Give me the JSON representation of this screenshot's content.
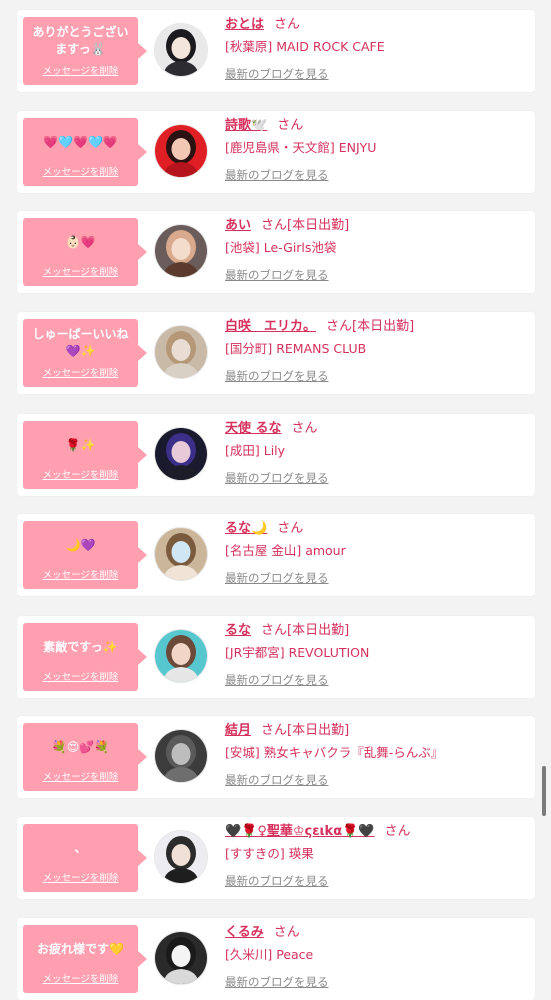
{
  "labels": {
    "san": "さん",
    "delete": "メッセージを削除",
    "blog": "最新のブログを見る"
  },
  "colors": {
    "bubble": "#ff9fb0",
    "name": "#d6305c",
    "muted": "#8a8a8a",
    "background": "#f3f3f3"
  },
  "cards": [
    {
      "message": "ありがとうございますっ🐰",
      "name": "おとは",
      "attendance": "",
      "shop": "[秋葉原] MAID ROCK CAFE",
      "avatar": {
        "bg": "#e9e9ea",
        "hair": "#1b1b1f",
        "skin": "#f3e4dc",
        "top": "#2b2b30"
      }
    },
    {
      "message": "💗🩵💗🩵💗",
      "name": "詩歌🕊️",
      "attendance": "",
      "shop": "[鹿児島県・天文館] ENJYU",
      "avatar": {
        "bg": "#e01f25",
        "hair": "#2a1212",
        "skin": "#f2c7b4",
        "top": "#b5141c"
      }
    },
    {
      "message": "👶🏻💗",
      "name": "あい",
      "attendance": "[本日出勤]",
      "shop": "[池袋] Le-Girls池袋",
      "avatar": {
        "bg": "#6b5c5c",
        "hair": "#d8a98c",
        "skin": "#f4dccd",
        "top": "#5a3b2e"
      }
    },
    {
      "message": "しゅーぱーいいね💜✨",
      "name": "白咲　エリカ。",
      "attendance": "[本日出勤]",
      "shop": "[国分町] REMANS CLUB",
      "avatar": {
        "bg": "#c9b9a7",
        "hair": "#b49878",
        "skin": "#e9ddd3",
        "top": "#d8cfc5"
      }
    },
    {
      "message": "🌹✨",
      "name": "天使 るな",
      "attendance": "",
      "shop": "[成田] Lily",
      "avatar": {
        "bg": "#1a1a2e",
        "hair": "#3b2f8a",
        "skin": "#e7c9d8",
        "top": "#1d1d29"
      }
    },
    {
      "message": "🌙💜",
      "name": "るな🌙",
      "attendance": "",
      "shop": "[名古屋 金山] amour",
      "avatar": {
        "bg": "#cbb69a",
        "hair": "#7b5b3e",
        "skin": "#cfe6f5",
        "top": "#efe4d6"
      }
    },
    {
      "message": "素敵ですっ✨",
      "name": "るな",
      "attendance": "[本日出勤]",
      "shop": "[JR宇都宮] REVOLUTION",
      "avatar": {
        "bg": "#56c7cf",
        "hair": "#6b4a3a",
        "skin": "#f1d6c8",
        "top": "#e6e6e6"
      }
    },
    {
      "message": "💐😍💕💐",
      "name": "結月",
      "attendance": "[本日出勤]",
      "shop": "[安城] 熟女キャバクラ『乱舞-らんぶ』",
      "avatar": {
        "bg": "#3c3c3c",
        "hair": "#5a5a5a",
        "skin": "#bdbdbd",
        "top": "#6e6e6e"
      }
    },
    {
      "message": "、",
      "name": "🖤🌹♀聖華♔ςειkα🌹🖤",
      "attendance": "",
      "shop": "[すすきの] 瑛果",
      "avatar": {
        "bg": "#ececf1",
        "hair": "#2b2b2b",
        "skin": "#f1e0d6",
        "top": "#1e1e1e"
      }
    },
    {
      "message": "お疲れ様です💛",
      "name": "くるみ",
      "attendance": "",
      "shop": "[久米川] Peace",
      "avatar": {
        "bg": "#2a2a2a",
        "hair": "#1a1a1a",
        "skin": "#f4f4f4",
        "top": "#d9d9d9"
      }
    }
  ]
}
